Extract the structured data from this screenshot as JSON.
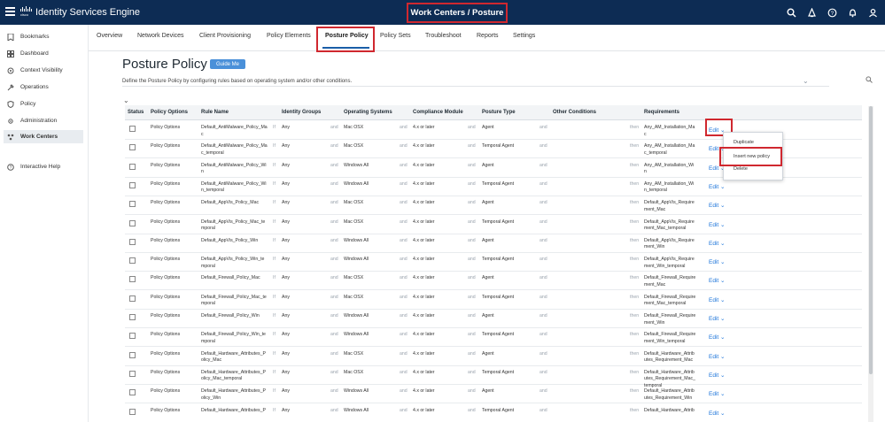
{
  "app": {
    "logo_text": "cisco",
    "title": "Identity Services Engine",
    "context_title": "Work Centers / Posture"
  },
  "top_icons": [
    "search-icon",
    "bell-icon",
    "help-icon",
    "notification-icon",
    "user-icon"
  ],
  "sidebar": {
    "items": [
      {
        "label": "Bookmarks",
        "icon": "bookmark-icon"
      },
      {
        "label": "Dashboard",
        "icon": "dashboard-icon"
      },
      {
        "label": "Context Visibility",
        "icon": "context-visibility-icon"
      },
      {
        "label": "Operations",
        "icon": "operations-icon"
      },
      {
        "label": "Policy",
        "icon": "policy-icon"
      },
      {
        "label": "Administration",
        "icon": "administration-icon"
      },
      {
        "label": "Work Centers",
        "icon": "work-centers-icon",
        "active": true
      },
      {
        "label": "Interactive Help",
        "icon": "interactive-help-icon"
      }
    ]
  },
  "subnav": {
    "tabs": [
      "Overview",
      "Network Devices",
      "Client Provisioning",
      "Policy Elements",
      "Posture Policy",
      "Policy Sets",
      "Troubleshoot",
      "Reports",
      "Settings"
    ],
    "active": "Posture Policy"
  },
  "page": {
    "title": "Posture Policy",
    "guide_button": "Guide Me",
    "description": "Define the Posture Policy by configuring rules based on operating system and/or other conditions."
  },
  "table": {
    "headers": [
      "Status",
      "Policy Options",
      "Rule Name",
      "Identity Groups",
      "Operating Systems",
      "Compliance Module",
      "Posture Type",
      "Other Conditions",
      "Requirements"
    ],
    "connectors": {
      "if": "If",
      "and": "and",
      "then": "then"
    },
    "edit_label": "Edit",
    "rows": [
      {
        "options": "Policy Options",
        "rule": [
          "Default_AntiMalware_Policy_Ma",
          "c"
        ],
        "groups": "Any",
        "os": "Mac OSX",
        "module": "4.x or later",
        "type": "Agent",
        "req": [
          "Any_AM_Installation_Ma",
          "c"
        ]
      },
      {
        "options": "Policy Options",
        "rule": [
          "Default_AntiMalware_Policy_Ma",
          "c_temporal"
        ],
        "groups": "Any",
        "os": "Mac OSX",
        "module": "4.x or later",
        "type": "Temporal Agent",
        "req": [
          "Any_AM_Installation_Ma",
          "c_temporal"
        ]
      },
      {
        "options": "Policy Options",
        "rule": [
          "Default_AntiMalware_Policy_Wi",
          "n"
        ],
        "groups": "Any",
        "os": "Windows All",
        "module": "4.x or later",
        "type": "Agent",
        "req": [
          "Any_AM_Installation_Wi",
          "n"
        ]
      },
      {
        "options": "Policy Options",
        "rule": [
          "Default_AntiMalware_Policy_Wi",
          "n_temporal"
        ],
        "groups": "Any",
        "os": "Windows All",
        "module": "4.x or later",
        "type": "Temporal Agent",
        "req": [
          "Any_AM_Installation_Wi",
          "n_temporal"
        ]
      },
      {
        "options": "Policy Options",
        "rule": [
          "Default_AppVis_Policy_Mac",
          ""
        ],
        "groups": "Any",
        "os": "Mac OSX",
        "module": "4.x or later",
        "type": "Agent",
        "req": [
          "Default_AppVis_Require",
          "ment_Mac"
        ]
      },
      {
        "options": "Policy Options",
        "rule": [
          "Default_AppVis_Policy_Mac_te",
          "mporal"
        ],
        "groups": "Any",
        "os": "Mac OSX",
        "module": "4.x or later",
        "type": "Temporal Agent",
        "req": [
          "Default_AppVis_Require",
          "ment_Mac_temporal"
        ]
      },
      {
        "options": "Policy Options",
        "rule": [
          "Default_AppVis_Policy_Win",
          ""
        ],
        "groups": "Any",
        "os": "Windows All",
        "module": "4.x or later",
        "type": "Agent",
        "req": [
          "Default_AppVis_Require",
          "ment_Win"
        ]
      },
      {
        "options": "Policy Options",
        "rule": [
          "Default_AppVis_Policy_Win_te",
          "mporal"
        ],
        "groups": "Any",
        "os": "Windows All",
        "module": "4.x or later",
        "type": "Temporal Agent",
        "req": [
          "Default_AppVis_Require",
          "ment_Win_temporal"
        ]
      },
      {
        "options": "Policy Options",
        "rule": [
          "Default_Firewall_Policy_Mac",
          ""
        ],
        "groups": "Any",
        "os": "Mac OSX",
        "module": "4.x or later",
        "type": "Agent",
        "req": [
          "Default_Firewall_Require",
          "ment_Mac"
        ]
      },
      {
        "options": "Policy Options",
        "rule": [
          "Default_Firewall_Policy_Mac_te",
          "mporal"
        ],
        "groups": "Any",
        "os": "Mac OSX",
        "module": "4.x or later",
        "type": "Temporal Agent",
        "req": [
          "Default_Firewall_Require",
          "ment_Mac_temporal"
        ]
      },
      {
        "options": "Policy Options",
        "rule": [
          "Default_Firewall_Policy_Win",
          ""
        ],
        "groups": "Any",
        "os": "Windows All",
        "module": "4.x or later",
        "type": "Agent",
        "req": [
          "Default_Firewall_Require",
          "ment_Win"
        ]
      },
      {
        "options": "Policy Options",
        "rule": [
          "Default_Firewall_Policy_Win_te",
          "mporal"
        ],
        "groups": "Any",
        "os": "Windows All",
        "module": "4.x or later",
        "type": "Temporal Agent",
        "req": [
          "Default_Firewall_Require",
          "ment_Win_temporal"
        ]
      },
      {
        "options": "Policy Options",
        "rule": [
          "Default_Hardware_Attributes_P",
          "olicy_Mac"
        ],
        "groups": "Any",
        "os": "Mac OSX",
        "module": "4.x or later",
        "type": "Agent",
        "req": [
          "Default_Hardware_Attrib",
          "utes_Requirement_Mac"
        ]
      },
      {
        "options": "Policy Options",
        "rule": [
          "Default_Hardware_Attributes_P",
          "olicy_Mac_temporal"
        ],
        "groups": "Any",
        "os": "Mac OSX",
        "module": "4.x or later",
        "type": "Temporal Agent",
        "req": [
          "Default_Hardware_Attrib",
          "utes_Requirement_Mac_",
          "temporal"
        ]
      },
      {
        "options": "Policy Options",
        "rule": [
          "Default_Hardware_Attributes_P",
          "olicy_Win"
        ],
        "groups": "Any",
        "os": "Windows All",
        "module": "4.x or later",
        "type": "Agent",
        "req": [
          "Default_Hardware_Attrib",
          "utes_Requirement_Win"
        ]
      },
      {
        "options": "Policy Options",
        "rule": [
          "Default_Hardware_Attributes_P",
          ""
        ],
        "groups": "Any",
        "os": "Windows All",
        "module": "4.x or later",
        "type": "Temporal Agent",
        "req": [
          "Default_Hardware_Attrib",
          ""
        ]
      }
    ]
  },
  "edit_menu": {
    "items": [
      "Duplicate",
      "Insert new policy",
      "Delete"
    ],
    "highlighted": "Insert new policy"
  },
  "colors": {
    "topbar": "#0d2c54",
    "accent": "#1a73d9",
    "annotation": "#d0282f",
    "guide_button": "#4a90d9"
  }
}
